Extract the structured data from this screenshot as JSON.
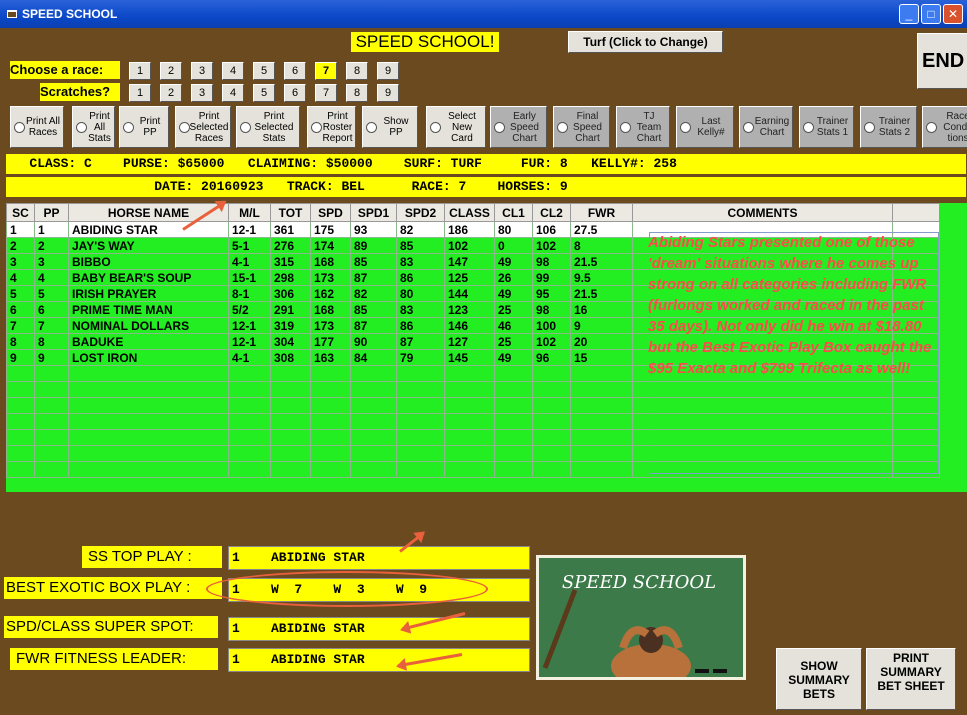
{
  "window": {
    "title": "SPEED SCHOOL",
    "end_label": "END"
  },
  "header": {
    "title": "SPEED SCHOOL!",
    "turf_button": "Turf (Click to Change)"
  },
  "race_select": {
    "label": "Choose  a race:",
    "numbers": [
      "1",
      "2",
      "3",
      "4",
      "5",
      "6",
      "7",
      "8",
      "9"
    ],
    "selected": "7"
  },
  "scratches": {
    "label": "Scratches?",
    "numbers": [
      "1",
      "2",
      "3",
      "4",
      "5",
      "6",
      "7",
      "8",
      "9"
    ]
  },
  "options": [
    {
      "label": "Print All Races"
    },
    {
      "label": "Print All Stats"
    },
    {
      "label": "Print PP"
    },
    {
      "label": "Print Selected Races"
    },
    {
      "label": "Print Selected Stats"
    },
    {
      "label": "Print Roster Report"
    },
    {
      "label": "Show PP"
    },
    {
      "label": "Select New Card"
    },
    {
      "label": "Early Speed Chart"
    },
    {
      "label": "Final Speed Chart"
    },
    {
      "label": "TJ Team Chart"
    },
    {
      "label": "Last Kelly#"
    },
    {
      "label": "Earning Chart"
    },
    {
      "label": "Trainer Stats 1"
    },
    {
      "label": "Trainer Stats 2"
    },
    {
      "label": "Race Condi-tions"
    }
  ],
  "race_info": {
    "line1": "   CLASS: C    PURSE: $65000   CLAIMING: $50000    SURF: TURF     FUR: 8   KELLY#: 258",
    "line2": "                   DATE: 20160923   TRACK: BEL      RACE: 7    HORSES: 9"
  },
  "table": {
    "headers": [
      "SC",
      "PP",
      "HORSE NAME",
      "M/L",
      "TOT",
      "SPD",
      "SPD1",
      "SPD2",
      "CLASS",
      "CL1",
      "CL2",
      "FWR",
      "COMMENTS"
    ],
    "rows": [
      [
        "1",
        "1",
        "ABIDING STAR",
        "12-1",
        "361",
        "175",
        "93",
        "82",
        "186",
        "80",
        "106",
        "27.5"
      ],
      [
        "2",
        "2",
        "JAY'S WAY",
        "5-1",
        "276",
        "174",
        "89",
        "85",
        "102",
        "0",
        "102",
        "8"
      ],
      [
        "3",
        "3",
        "BIBBO",
        "4-1",
        "315",
        "168",
        "85",
        "83",
        "147",
        "49",
        "98",
        "21.5"
      ],
      [
        "4",
        "4",
        "BABY BEAR'S SOUP",
        "15-1",
        "298",
        "173",
        "87",
        "86",
        "125",
        "26",
        "99",
        "9.5"
      ],
      [
        "5",
        "5",
        "IRISH PRAYER",
        "8-1",
        "306",
        "162",
        "82",
        "80",
        "144",
        "49",
        "95",
        "21.5"
      ],
      [
        "6",
        "6",
        "PRIME TIME MAN",
        "5/2",
        "291",
        "168",
        "85",
        "83",
        "123",
        "25",
        "98",
        "16"
      ],
      [
        "7",
        "7",
        "NOMINAL DOLLARS",
        "12-1",
        "319",
        "173",
        "87",
        "86",
        "146",
        "46",
        "100",
        "9"
      ],
      [
        "8",
        "8",
        "BADUKE",
        "12-1",
        "304",
        "177",
        "90",
        "87",
        "127",
        "25",
        "102",
        "20"
      ],
      [
        "9",
        "9",
        "LOST IRON",
        "4-1",
        "308",
        "163",
        "84",
        "79",
        "145",
        "49",
        "96",
        "15"
      ]
    ],
    "comment": "Abiding Stars presented one of those 'dream' situations where he comes up strong on all categories including FWR (furlongs worked and raced in the past 35 days). Not only did he win at $18.80 but the Best Exotic Play Box caught the $95 Exacta and $799 Trifecta as well!"
  },
  "plays": {
    "ss_top_label": "SS TOP PLAY :",
    "ss_top_value": "1    ABIDING STAR",
    "exotic_label": "BEST EXOTIC BOX PLAY :",
    "exotic_value": "1    W  7    W  3    W  9",
    "super_label": "SPD/CLASS SUPER SPOT:",
    "super_value": "1    ABIDING STAR",
    "fwr_label": "FWR FITNESS LEADER:",
    "fwr_value": "1    ABIDING STAR"
  },
  "logo_text": "SPEED SCHOOL",
  "buttons": {
    "show_summary": "SHOW SUMMARY BETS",
    "print_summary": "PRINT SUMMARY BET SHEET"
  },
  "colors": {
    "background": "#6b4a1f",
    "highlight": "#ffff00",
    "grid": "#22ee22",
    "comment": "#ff4a4a",
    "annotation": "#e8603c"
  }
}
